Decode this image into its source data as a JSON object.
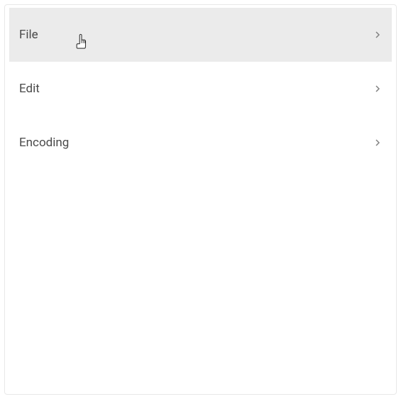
{
  "menu": {
    "items": [
      {
        "label": "File",
        "hovered": true
      },
      {
        "label": "Edit",
        "hovered": false
      },
      {
        "label": "Encoding",
        "hovered": false
      }
    ]
  }
}
